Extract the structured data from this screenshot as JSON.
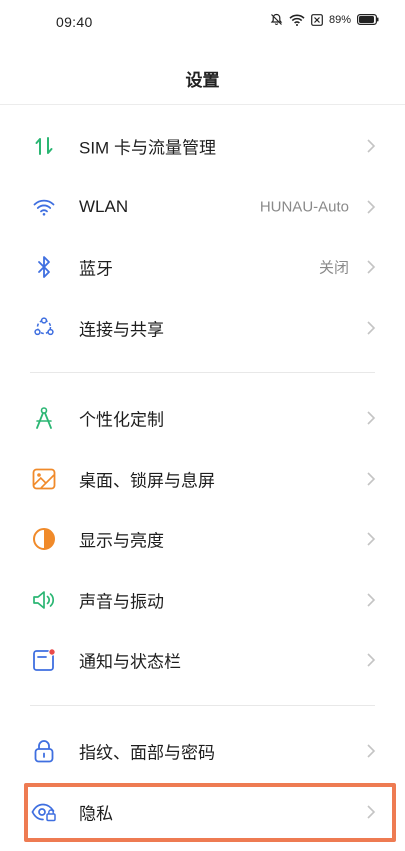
{
  "status_bar": {
    "time": "09:40",
    "battery": "89%"
  },
  "header": {
    "title": "设置"
  },
  "groups": [
    {
      "items": [
        {
          "label": "SIM 卡与流量管理",
          "value": ""
        },
        {
          "label": "WLAN",
          "value": "HUNAU-Auto"
        },
        {
          "label": "蓝牙",
          "value": "关闭"
        },
        {
          "label": "连接与共享",
          "value": ""
        }
      ]
    },
    {
      "items": [
        {
          "label": "个性化定制",
          "value": ""
        },
        {
          "label": "桌面、锁屏与息屏",
          "value": ""
        },
        {
          "label": "显示与亮度",
          "value": ""
        },
        {
          "label": "声音与振动",
          "value": ""
        },
        {
          "label": "通知与状态栏",
          "value": ""
        }
      ]
    },
    {
      "items": [
        {
          "label": "指纹、面部与密码",
          "value": ""
        },
        {
          "label": "隐私",
          "value": ""
        }
      ]
    }
  ],
  "colors": {
    "highlight": "#ee7b52",
    "accent_blue": "#3f6fe0",
    "accent_green": "#2bb673",
    "accent_orange": "#f08a2a"
  }
}
